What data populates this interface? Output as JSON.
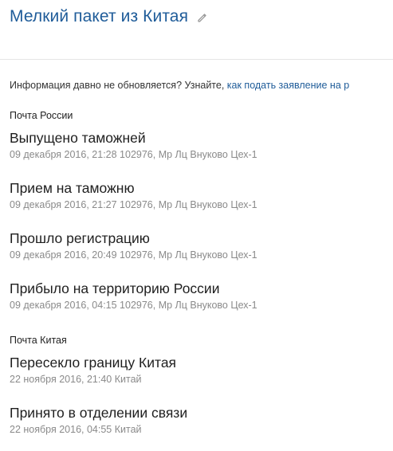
{
  "header": {
    "title": "Мелкий пакет из Китая",
    "edit_icon": "pencil-icon"
  },
  "notice": {
    "text": "Информация давно не обновляется? Узнайте, ",
    "link_text": "как подать заявление на р"
  },
  "sections": [
    {
      "name": "Почта России",
      "events": [
        {
          "title": "Выпущено таможней",
          "detail": "09 декабря 2016, 21:28 102976, Мр Лц Внуково Цех-1"
        },
        {
          "title": "Прием на таможню",
          "detail": "09 декабря 2016, 21:27 102976, Мр Лц Внуково Цех-1"
        },
        {
          "title": "Прошло регистрацию",
          "detail": "09 декабря 2016, 20:49 102976, Мр Лц Внуково Цех-1"
        },
        {
          "title": "Прибыло на территорию России",
          "detail": "09 декабря 2016, 04:15 102976, Мр Лц Внуково Цех-1"
        }
      ]
    },
    {
      "name": "Почта Китая",
      "events": [
        {
          "title": "Пересекло границу Китая",
          "detail": "22 ноября 2016, 21:40 Китай"
        },
        {
          "title": "Принято в отделении связи",
          "detail": "22 ноября 2016, 04:55 Китай"
        }
      ]
    }
  ]
}
